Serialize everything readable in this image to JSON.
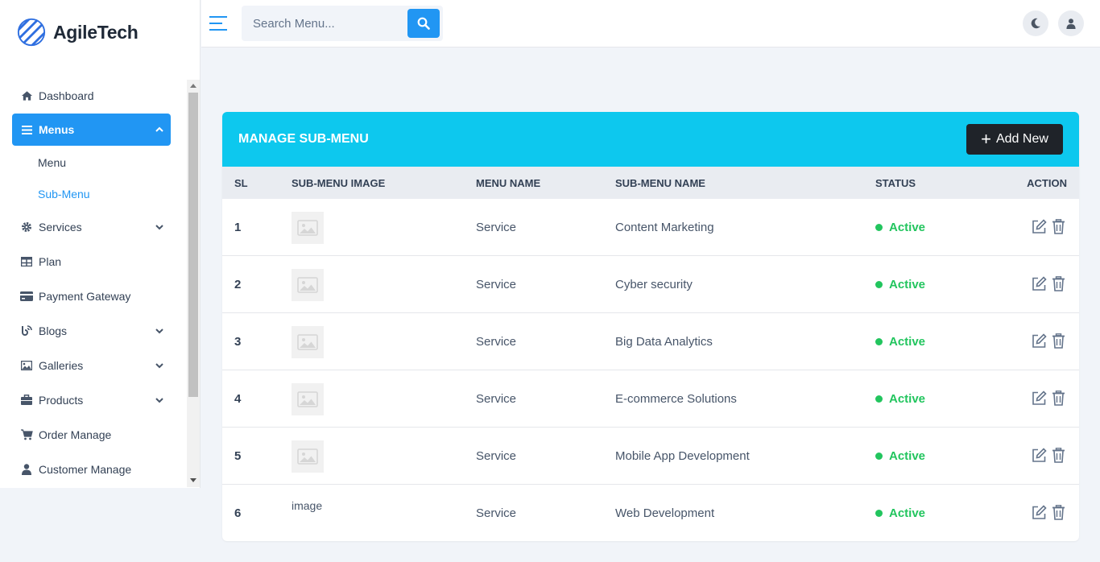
{
  "brand": {
    "name": "AgileTech"
  },
  "sidebar": {
    "items": [
      {
        "label": "Dashboard",
        "icon": "home-icon"
      },
      {
        "label": "Menus",
        "icon": "list-icon",
        "expanded": true,
        "children": [
          {
            "label": "Menu"
          },
          {
            "label": "Sub-Menu",
            "current": true
          }
        ]
      },
      {
        "label": "Services",
        "icon": "gear-icon",
        "has_children": true
      },
      {
        "label": "Plan",
        "icon": "table-icon"
      },
      {
        "label": "Payment Gateway",
        "icon": "credit-card-icon"
      },
      {
        "label": "Blogs",
        "icon": "blog-icon",
        "has_children": true
      },
      {
        "label": "Galleries",
        "icon": "image-icon",
        "has_children": true
      },
      {
        "label": "Products",
        "icon": "briefcase-icon",
        "has_children": true
      },
      {
        "label": "Order Manage",
        "icon": "cart-icon"
      },
      {
        "label": "Customer Manage",
        "icon": "user-icon"
      }
    ]
  },
  "header": {
    "search": {
      "placeholder": "Search Menu...",
      "value": ""
    },
    "icons": {
      "theme": "moon-icon",
      "profile": "user-icon"
    }
  },
  "card": {
    "title": "MANAGE SUB-MENU",
    "add_button": "Add New",
    "accent": "#0dc8ee"
  },
  "table": {
    "columns": [
      "SL",
      "SUB-MENU IMAGE",
      "MENU NAME",
      "SUB-MENU NAME",
      "STATUS",
      "ACTION"
    ],
    "rows": [
      {
        "sl": "1",
        "image": "placeholder",
        "menu": "Service",
        "submenu": "Content Marketing",
        "status": "Active"
      },
      {
        "sl": "2",
        "image": "placeholder",
        "menu": "Service",
        "submenu": "Cyber security",
        "status": "Active"
      },
      {
        "sl": "3",
        "image": "placeholder",
        "menu": "Service",
        "submenu": "Big Data Analytics",
        "status": "Active"
      },
      {
        "sl": "4",
        "image": "placeholder",
        "menu": "Service",
        "submenu": "E-commerce Solutions",
        "status": "Active"
      },
      {
        "sl": "5",
        "image": "placeholder",
        "menu": "Service",
        "submenu": "Mobile App Development",
        "status": "Active"
      },
      {
        "sl": "6",
        "image": "broken",
        "image_alt": "image",
        "menu": "Service",
        "submenu": "Web Development",
        "status": "Active"
      }
    ]
  },
  "colors": {
    "primary": "#2196f3",
    "success": "#22c55e",
    "dark_button": "#1f2329"
  }
}
